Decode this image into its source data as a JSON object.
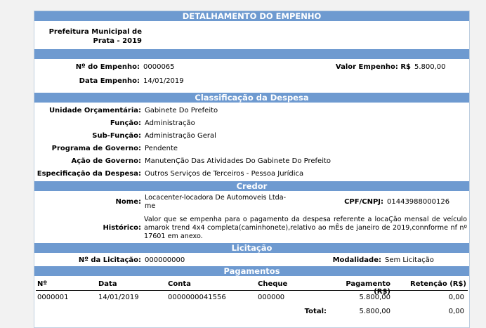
{
  "header": {
    "title": "DETALHAMENTO DO EMPENHO"
  },
  "entity": {
    "name_line1": "Prefeitura Municipal de",
    "name_line2": "Prata - 2019"
  },
  "empenho": {
    "numero_label": "Nº do Empenho:",
    "numero": "0000065",
    "valor_label": "Valor Empenho: R$",
    "valor": "5.800,00",
    "data_label": "Data Empenho:",
    "data": "14/01/2019"
  },
  "classificacao": {
    "title": "Classificação da Despesa",
    "unidade_label": "Unidade Orçamentária:",
    "unidade": "Gabinete Do Prefeito",
    "funcao_label": "Função:",
    "funcao": "Administração",
    "subfuncao_label": "Sub-Função:",
    "subfuncao": "Administração Geral",
    "programa_label": "Programa de Governo:",
    "programa": "Pendente",
    "acao_label": "Ação de Governo:",
    "acao": "ManutenÇão Das Atividades Do Gabinete Do Prefeito",
    "especificacao_label": "Especificação da Despesa:",
    "especificacao": "Outros Serviços de Terceiros - Pessoa Jurídica"
  },
  "credor": {
    "title": "Credor",
    "nome_label": "Nome:",
    "nome_line1": "Locacenter-locadora De Automoveis Ltda-",
    "nome_line2": "me",
    "cpf_label": "CPF/CNPJ:",
    "cpf": "01443988000126",
    "historico_label": "Histórico:",
    "historico": "Valor que se empenha para o pagamento da despesa referente a locaÇão mensal de veículo amarok trend 4x4 completa(caminhonete),relativo ao mÊs de janeiro de 2019,connforme nf nº 17601 em anexo."
  },
  "licitacao": {
    "title": "Licitação",
    "numero_label": "Nº da Licitação:",
    "numero": "000000000",
    "modalidade_label": "Modalidade:",
    "modalidade": "Sem Licitação"
  },
  "pagamentos": {
    "title": "Pagamentos",
    "columns": [
      "Nº",
      "Data",
      "Conta",
      "Cheque",
      "Pagamento (R$)",
      "Retenção (R$)"
    ],
    "rows": [
      {
        "numero": "0000001",
        "data": "14/01/2019",
        "conta": "0000000041556",
        "cheque": "000000",
        "pagamento": "5.800,00",
        "retencao": "0,00"
      }
    ],
    "total_label": "Total:",
    "total_pagamento": "5.800,00",
    "total_retencao": "0,00"
  }
}
